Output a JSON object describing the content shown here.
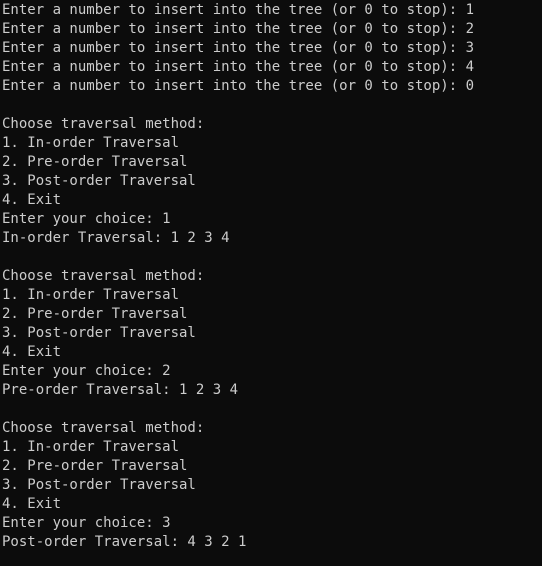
{
  "terminal": {
    "background": "#0c0c0c",
    "foreground": "#cccccc",
    "lines": [
      "Enter a number to insert into the tree (or 0 to stop): 1",
      "Enter a number to insert into the tree (or 0 to stop): 2",
      "Enter a number to insert into the tree (or 0 to stop): 3",
      "Enter a number to insert into the tree (or 0 to stop): 4",
      "Enter a number to insert into the tree (or 0 to stop): 0",
      "",
      "Choose traversal method:",
      "1. In-order Traversal",
      "2. Pre-order Traversal",
      "3. Post-order Traversal",
      "4. Exit",
      "Enter your choice: 1",
      "In-order Traversal: 1 2 3 4",
      "",
      "Choose traversal method:",
      "1. In-order Traversal",
      "2. Pre-order Traversal",
      "3. Post-order Traversal",
      "4. Exit",
      "Enter your choice: 2",
      "Pre-order Traversal: 1 2 3 4",
      "",
      "Choose traversal method:",
      "1. In-order Traversal",
      "2. Pre-order Traversal",
      "3. Post-order Traversal",
      "4. Exit",
      "Enter your choice: 3",
      "Post-order Traversal: 4 3 2 1"
    ]
  }
}
